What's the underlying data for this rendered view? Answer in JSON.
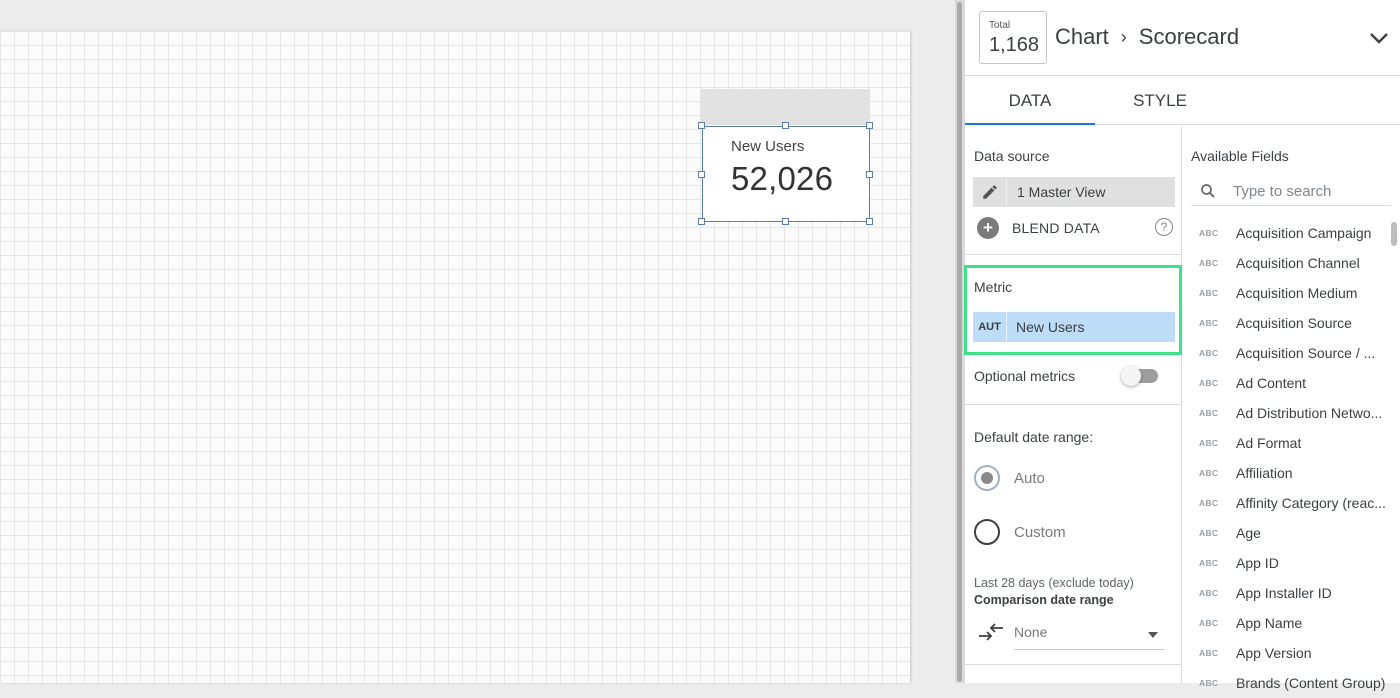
{
  "canvas": {
    "scorecard": {
      "label": "New Users",
      "value": "52,026"
    }
  },
  "panel": {
    "header": {
      "total_label": "Total",
      "total_value": "1,168",
      "crumb_chart": "Chart",
      "crumb_sep": "›",
      "crumb_type": "Scorecard"
    },
    "tabs": [
      {
        "label": "DATA",
        "active": true
      },
      {
        "label": "STYLE",
        "active": false
      }
    ],
    "data_source": {
      "label": "Data source",
      "name": "1 Master View",
      "blend_label": "BLEND DATA",
      "help_glyph": "?"
    },
    "metric": {
      "label": "Metric",
      "type_badge": "AUT",
      "name": "New Users",
      "highlight_color": "#3ee08a"
    },
    "optional_metrics": {
      "label": "Optional metrics",
      "enabled": false
    },
    "date_range": {
      "label": "Default date range:",
      "options": [
        {
          "label": "Auto",
          "selected": true
        },
        {
          "label": "Custom",
          "selected": false
        }
      ],
      "note": "Last 28 days (exclude today)",
      "comparison_label": "Comparison date range",
      "comparison_value": "None"
    },
    "available_fields": {
      "title": "Available Fields",
      "search_placeholder": "Type to search",
      "type_badge": "ABC",
      "items": [
        "Acquisition Campaign",
        "Acquisition Channel",
        "Acquisition Medium",
        "Acquisition Source",
        "Acquisition Source / ...",
        "Ad Content",
        "Ad Distribution Netwo...",
        "Ad Format",
        "Affiliation",
        "Affinity Category (reac...",
        "Age",
        "App ID",
        "App Installer ID",
        "App Name",
        "App Version",
        "Brands (Content Group)"
      ]
    }
  }
}
